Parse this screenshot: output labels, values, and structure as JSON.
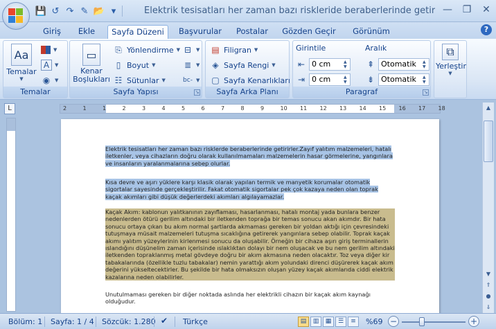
{
  "window": {
    "title": "Elektrik tesisatları her zaman bazı riskleride beraberlerinde getirirler - Microsoft Word"
  },
  "tabs": [
    "Giriş",
    "Ekle",
    "Sayfa Düzeni",
    "Başvurular",
    "Postalar",
    "Gözden Geçir",
    "Görünüm"
  ],
  "active_tab": "Sayfa Düzeni",
  "ribbon": {
    "temalar": {
      "group_label": "Temalar",
      "button_label": "Temalar"
    },
    "sayfa_yapisi": {
      "group_label": "Sayfa Yapısı",
      "margins_label": "Kenar Boşlukları",
      "orientation_label": "Yönlendirme",
      "size_label": "Boyut",
      "columns_label": "Sütunlar"
    },
    "sayfa_arka_plani": {
      "group_label": "Sayfa Arka Planı",
      "watermark_label": "Filigran",
      "page_color_label": "Sayfa Rengi",
      "page_borders_label": "Sayfa Kenarlıkları"
    },
    "paragraf": {
      "group_label": "Paragraf",
      "indent_label": "Girintile",
      "spacing_label": "Aralık",
      "indent_left": "0 cm",
      "indent_right": "0 cm",
      "spacing_before": "Otomatik",
      "spacing_after": "Otomatik"
    },
    "yerlestir": {
      "button_label": "Yerleştir"
    }
  },
  "ruler": {
    "ticks": [
      "2",
      "1",
      "1",
      "2",
      "3",
      "4",
      "5",
      "6",
      "7",
      "8",
      "9",
      "10",
      "11",
      "12",
      "13",
      "14",
      "15",
      "16",
      "17",
      "18"
    ]
  },
  "document": {
    "paragraphs": [
      {
        "text": "Elektrik tesisatları her zaman bazı risklerde beraberlerinde getirirler.Zayıf yalıtım malzemeleri, hatalı iletkenler, veya cihazların doğru olarak kullanılmamaları malzemelerin hasar görmelerine, yangınlara ve insanların yaralanmalarına sebep olurlar.",
        "style": "blue"
      },
      {
        "text": "Kısa devre ve aşırı yüklere karşı klasik olarak yapılan termik ve manyetik korumalar otomatik sigortalar sayesinde gerçekleştirilir. Fakat otomatik sigortalar pek çok kazaya neden olan toprak kaçak akımları gibi düşük değerlerdeki akımları algılayamazlar.",
        "style": "blue"
      },
      {
        "text": "Kaçak Akım: kablonun yalıtkanının zayıflaması, hasarlanması, hatalı montaj yada bunlara benzer nedenlerden ötürü gerilim altındaki bir iletkenden toprağa bir temas sonucu akan akımdır. Bir hata sonucu ortaya çıkan bu akım normal şartlarda akmaması gereken bir yoldan aktığı için çevresindeki tutuşmaya müsait malzemeleri tutuşma sıcaklığına getirerek yangınlara sebep olabilir. Toprak kaçak akımı yalıtım yüzeylerinin kirlenmesi sonucu da oluşabilir. Örneğin bir cihaza aşırı giriş terminallerin ıslandığını düşünelim zaman içerisinde ıslaklıktan dolayı bir nem oluşacak ve bu nem gerilim altındaki iletkenden topraklanmış metal gövdeye doğru bir akım akmasına neden olacaktır. Toz veya diğer kir tabakalarında (özellikle tuzlu tabakalar) nemin yarattığı akım yolundaki direnci düşürerek kaçak akım değerini yükseltecektirler. Bu şekilde bir hata olmaksızın oluşan yüzey kaçak akımlarıda ciddi elektrik kazalarına neden olabilirler.",
        "style": "tan"
      },
      {
        "text": "Unutulmaması gereken bir diğer noktada aslında her elektrikli cihazın bir kaçak akım kaynağı olduğudur.",
        "style": "plain"
      }
    ]
  },
  "status": {
    "section": "Bölüm: 1",
    "page": "Sayfa: 1 / 4",
    "words": "Sözcük: 1.280",
    "language": "Türkçe",
    "zoom": "%69",
    "zoom_value": 69
  }
}
